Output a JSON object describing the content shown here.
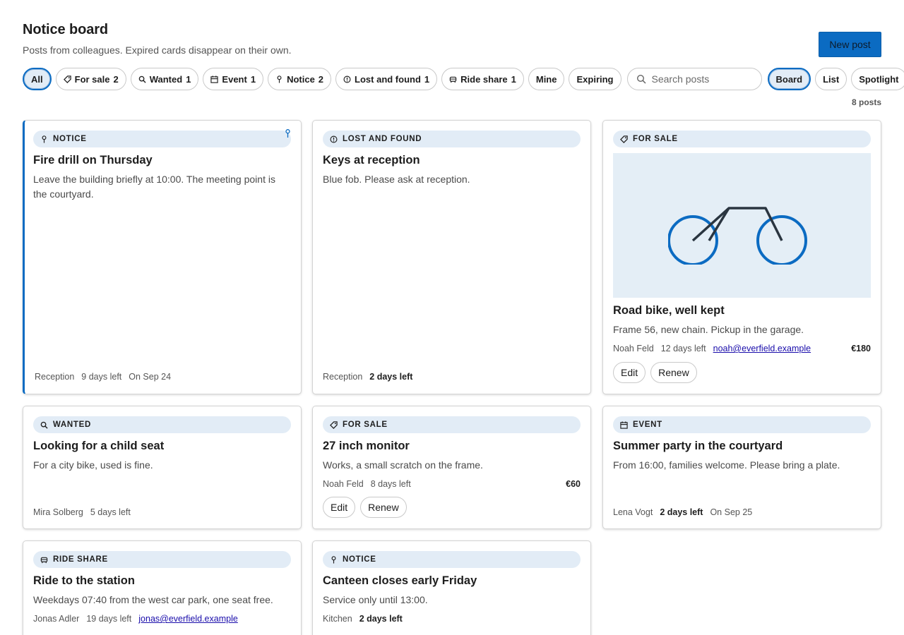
{
  "header": {
    "title": "Notice board",
    "subtitle": "Posts from colleagues. Expired cards disappear on their own.",
    "new_post_label": "New post"
  },
  "filters": {
    "chips": [
      {
        "label": "All",
        "count": "",
        "icon": "",
        "active": true
      },
      {
        "label": "For sale",
        "count": "2",
        "icon": "tag-icon"
      },
      {
        "label": "Wanted",
        "count": "1",
        "icon": "search-icon"
      },
      {
        "label": "Event",
        "count": "1",
        "icon": "calendar-icon"
      },
      {
        "label": "Notice",
        "count": "2",
        "icon": "pin-icon"
      },
      {
        "label": "Lost and found",
        "count": "1",
        "icon": "info-icon"
      },
      {
        "label": "Ride share",
        "count": "1",
        "icon": "car-icon"
      },
      {
        "label": "Mine",
        "count": "",
        "icon": ""
      },
      {
        "label": "Expiring",
        "count": "",
        "icon": ""
      }
    ],
    "search_placeholder": "Search posts",
    "views": [
      {
        "label": "Board",
        "active": true
      },
      {
        "label": "List"
      },
      {
        "label": "Spotlight"
      }
    ]
  },
  "post_count": "8 posts",
  "colors": {
    "accent": "#0b6bc2",
    "badge_bg": "#e2ecf6",
    "photo_bg": "#e4eef6"
  },
  "cards": [
    {
      "category": "NOTICE",
      "icon": "pin-icon",
      "title": "Fire drill on Thursday",
      "body": "Leave the building briefly at 10:00. The meeting point is the courtyard.",
      "meta": [
        "Reception",
        "9 days left",
        "On Sep 24"
      ],
      "pinned": true
    },
    {
      "category": "LOST AND FOUND",
      "icon": "info-icon",
      "title": "Keys at reception",
      "body": "Blue fob. Please ask at reception.",
      "meta": [
        "Reception",
        "2 days left"
      ]
    },
    {
      "category": "FOR SALE",
      "icon": "tag-icon",
      "title": "Road bike, well kept",
      "body": "Frame 56, new chain. Pickup in the garage.",
      "meta": [
        "Noah Feld",
        "12 days left"
      ],
      "email": "noah@everfield.example",
      "price": "€180",
      "actions": [
        "Edit",
        "Renew"
      ],
      "image": "bicycle-image"
    },
    {
      "category": "WANTED",
      "icon": "search-icon",
      "title": "Looking for a child seat",
      "body": "For a city bike, used is fine.",
      "meta": [
        "Mira Solberg",
        "5 days left"
      ]
    },
    {
      "category": "FOR SALE",
      "icon": "tag-icon",
      "title": "27 inch monitor",
      "body": "Works, a small scratch on the frame.",
      "meta": [
        "Noah Feld",
        "8 days left"
      ],
      "price": "€60",
      "actions": [
        "Edit",
        "Renew"
      ]
    },
    {
      "category": "EVENT",
      "icon": "calendar-icon",
      "title": "Summer party in the courtyard",
      "body": "From 16:00, families welcome. Please bring a plate.",
      "meta": [
        "Lena Vogt",
        "2 days left",
        "On Sep 25"
      ]
    },
    {
      "category": "RIDE SHARE",
      "icon": "car-icon",
      "title": "Ride to the station",
      "body": "Weekdays 07:40 from the west car park, one seat free.",
      "meta": [
        "Jonas Adler",
        "19 days left"
      ],
      "email": "jonas@everfield.example"
    },
    {
      "category": "NOTICE",
      "icon": "pin-icon",
      "title": "Canteen closes early Friday",
      "body": "Service only until 13:00.",
      "meta": [
        "Kitchen",
        "2 days left"
      ]
    }
  ]
}
